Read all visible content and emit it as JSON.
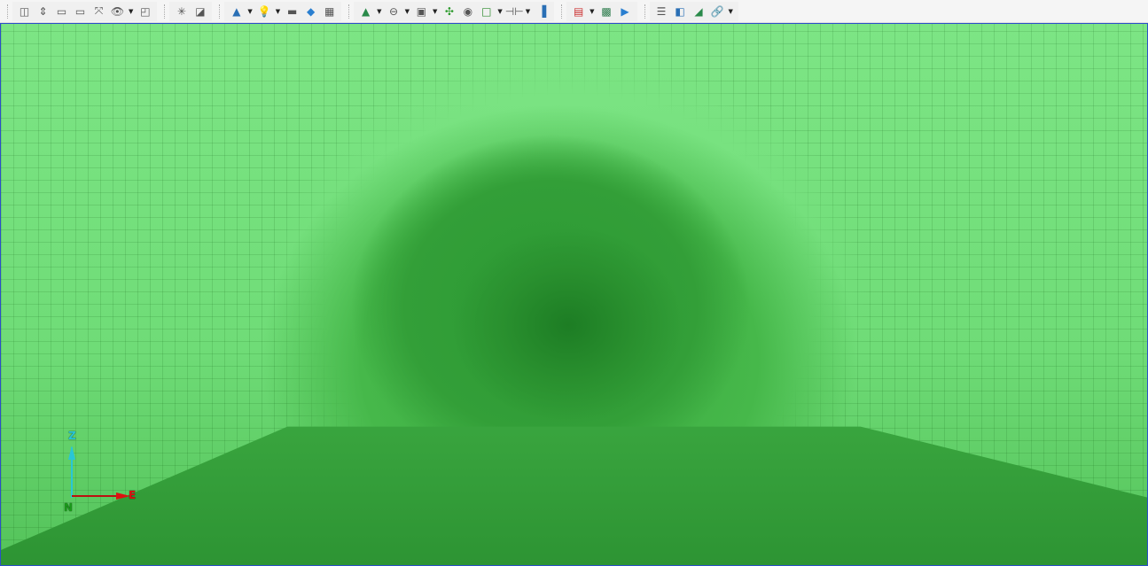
{
  "toolbar": {
    "groups": [
      [
        "view-cube-icon",
        "fit-view-icon",
        "zoom-extents-icon",
        "zoom-selection-icon",
        "zoom-fit-icon",
        "visibility-eye-icon",
        "perspective-box-icon"
      ],
      [
        "select-all-icon",
        "deselect-icon"
      ],
      [
        "point-tool-icon",
        "light-bulb-icon",
        "camera-icon",
        "marker-icon",
        "grid-icon"
      ],
      [
        "section-tool-icon",
        "clipping-plane-icon",
        "save-layer-icon",
        "crosshair-icon",
        "orbit-center-icon",
        "box-icon",
        "flip-icon",
        "split-view-icon"
      ],
      [
        "pdf-export-icon",
        "image-export-icon",
        "play-icon"
      ],
      [
        "list-icon",
        "compare-icon",
        "profile-icon",
        "link-icon"
      ]
    ]
  },
  "axes": {
    "z": "Z",
    "e": "E",
    "n": "N",
    "colors": {
      "z": "#29c6d6",
      "e": "#d11",
      "n": "#1a9a1a"
    }
  }
}
